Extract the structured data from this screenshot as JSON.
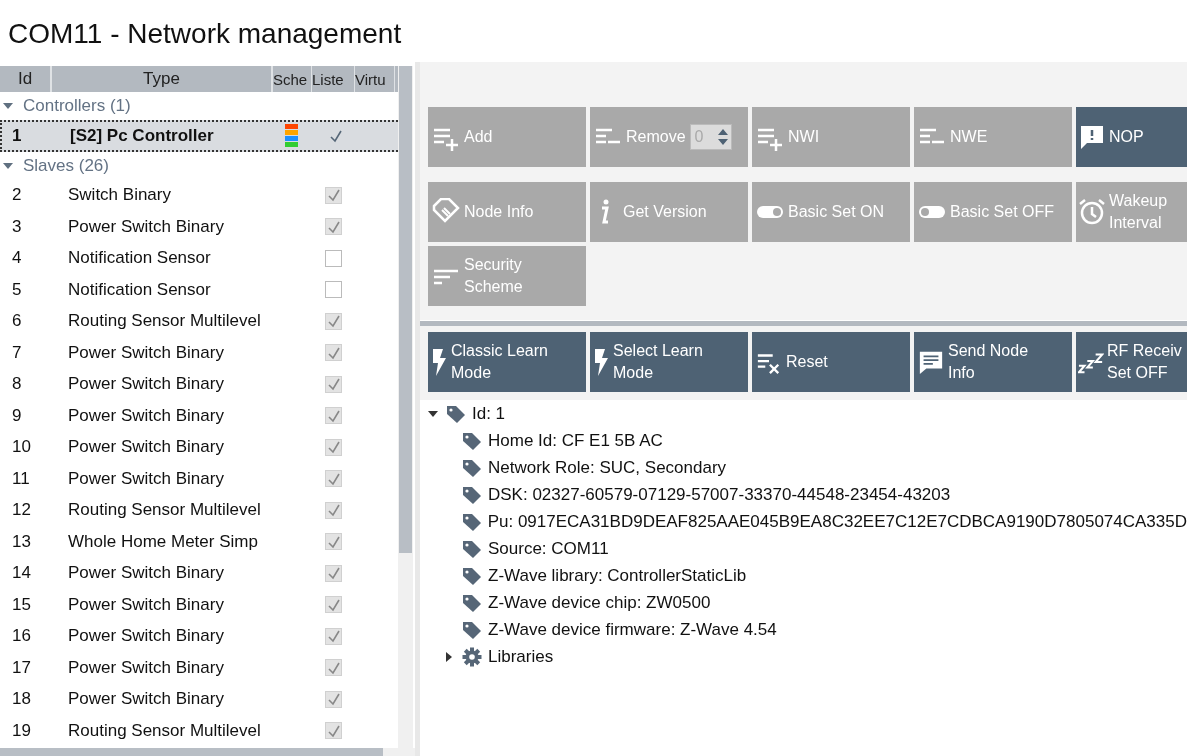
{
  "window": {
    "title": "COM11 - Network management"
  },
  "table": {
    "columns": [
      "Id",
      "Type",
      "Sche",
      "Liste",
      "Virtu"
    ],
    "groups": [
      {
        "label": "Controllers (1)",
        "expanded": true,
        "rows": [
          {
            "id": "1",
            "type": "[S2] Pc Controller",
            "selected": true,
            "schemes": [
              {
                "color": "#ff4500"
              },
              {
                "color": "#ffa500"
              },
              {
                "color": "#1e90ff"
              },
              {
                "color": "#32cd32"
              }
            ],
            "listening": true
          }
        ]
      },
      {
        "label": "Slaves (26)",
        "expanded": true,
        "rows": [
          {
            "id": "2",
            "type": "Switch Binary",
            "selected": false,
            "listening": true
          },
          {
            "id": "3",
            "type": "Power Switch Binary",
            "selected": false,
            "listening": true
          },
          {
            "id": "4",
            "type": "Notification Sensor",
            "selected": false,
            "listening": false
          },
          {
            "id": "5",
            "type": "Notification Sensor",
            "selected": false,
            "listening": false
          },
          {
            "id": "6",
            "type": "Routing Sensor Multilevel",
            "selected": false,
            "listening": true
          },
          {
            "id": "7",
            "type": "Power Switch Binary",
            "selected": false,
            "listening": true
          },
          {
            "id": "8",
            "type": "Power Switch Binary",
            "selected": false,
            "listening": true
          },
          {
            "id": "9",
            "type": "Power Switch Binary",
            "selected": false,
            "listening": true
          },
          {
            "id": "10",
            "type": "Power Switch Binary",
            "selected": false,
            "listening": true
          },
          {
            "id": "11",
            "type": "Power Switch Binary",
            "selected": false,
            "listening": true
          },
          {
            "id": "12",
            "type": "Routing Sensor Multilevel",
            "selected": false,
            "listening": true
          },
          {
            "id": "13",
            "type": "Whole Home Meter Simp",
            "selected": false,
            "listening": true
          },
          {
            "id": "14",
            "type": "Power Switch Binary",
            "selected": false,
            "listening": true
          },
          {
            "id": "15",
            "type": "Power Switch Binary",
            "selected": false,
            "listening": true
          },
          {
            "id": "16",
            "type": "Power Switch Binary",
            "selected": false,
            "listening": true
          },
          {
            "id": "17",
            "type": "Power Switch Binary",
            "selected": false,
            "listening": true
          },
          {
            "id": "18",
            "type": "Power Switch Binary",
            "selected": false,
            "listening": true
          },
          {
            "id": "19",
            "type": "Routing Sensor Multilevel",
            "selected": false,
            "listening": true
          }
        ]
      }
    ]
  },
  "command_rows": [
    [
      {
        "lines": [
          "Add"
        ],
        "active": false
      },
      {
        "lines": [
          "Remove"
        ],
        "active": false,
        "spin_value": "0"
      },
      {
        "lines": [
          "NWI"
        ],
        "active": false
      },
      {
        "lines": [
          "NWE"
        ],
        "active": false
      },
      {
        "lines": [
          "NOP"
        ],
        "active": true
      }
    ],
    [
      {
        "lines": [
          "Node Info"
        ],
        "active": false
      },
      {
        "lines": [
          "Get Version"
        ],
        "active": false
      },
      {
        "lines": [
          "Basic Set ON"
        ],
        "active": false
      },
      {
        "lines": [
          "Basic Set OFF"
        ],
        "active": false
      },
      {
        "lines": [
          "Wakeup",
          "Interval"
        ],
        "active": false
      }
    ],
    [
      {
        "lines": [
          "Security",
          "Scheme"
        ],
        "active": false
      }
    ]
  ],
  "learn_buttons": [
    {
      "lines": [
        "Classic Learn",
        "Mode"
      ]
    },
    {
      "lines": [
        "Select Learn",
        "Mode"
      ]
    },
    {
      "lines": [
        "Reset"
      ]
    },
    {
      "lines": [
        "Send Node",
        "Info"
      ]
    },
    {
      "lines": [
        "RF Receiv",
        "Set OFF"
      ]
    }
  ],
  "tree": [
    {
      "label": "Id: 1",
      "expanded": true,
      "children": [
        {
          "label": "Home Id: CF E1 5B AC"
        },
        {
          "label": "Network Role: SUC, Secondary"
        },
        {
          "label": "DSK: 02327-60579-07129-57007-33370-44548-23454-43203"
        },
        {
          "label": "Pu: 0917ECA31BD9DEAF825AAE045B9EA8C32EE7C12E7CDBCA9190D7805074CA335D"
        },
        {
          "label": "Source: COM11"
        },
        {
          "label": "Z-Wave library: ControllerStaticLib"
        },
        {
          "label": "Z-Wave device chip: ZW0500"
        },
        {
          "label": "Z-Wave device firmware: Z-Wave 4.54"
        },
        {
          "label": "Libraries",
          "expanded": false
        }
      ]
    }
  ]
}
